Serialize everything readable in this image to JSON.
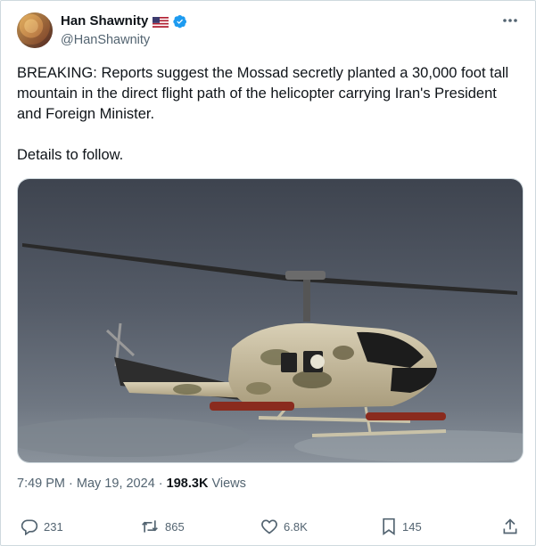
{
  "author": {
    "display_name": "Han Shawnity",
    "handle": "@HanShawnity"
  },
  "tweet": {
    "text": "BREAKING: Reports suggest the Mossad secretly planted a 30,000 foot tall mountain in the direct flight path of the helicopter carrying Iran's President and Foreign Minister.\n\nDetails to follow."
  },
  "meta": {
    "time": "7:49 PM",
    "separator1": " · ",
    "date": "May 19, 2024",
    "separator2": " · ",
    "views_count": "198.3K",
    "views_label": " Views"
  },
  "actions": {
    "replies": "231",
    "reposts": "865",
    "likes": "6.8K",
    "bookmarks": "145"
  },
  "colors": {
    "text_primary": "#0f1419",
    "text_secondary": "#536471",
    "verified_blue": "#1d9bf0",
    "border": "#cfd9de"
  },
  "icons": {
    "more": "more-horizontal-icon",
    "reply": "reply-icon",
    "repost": "repost-icon",
    "like": "heart-icon",
    "bookmark": "bookmark-icon",
    "share": "share-icon",
    "verified": "verified-badge-icon",
    "flag": "us-flag-icon"
  }
}
